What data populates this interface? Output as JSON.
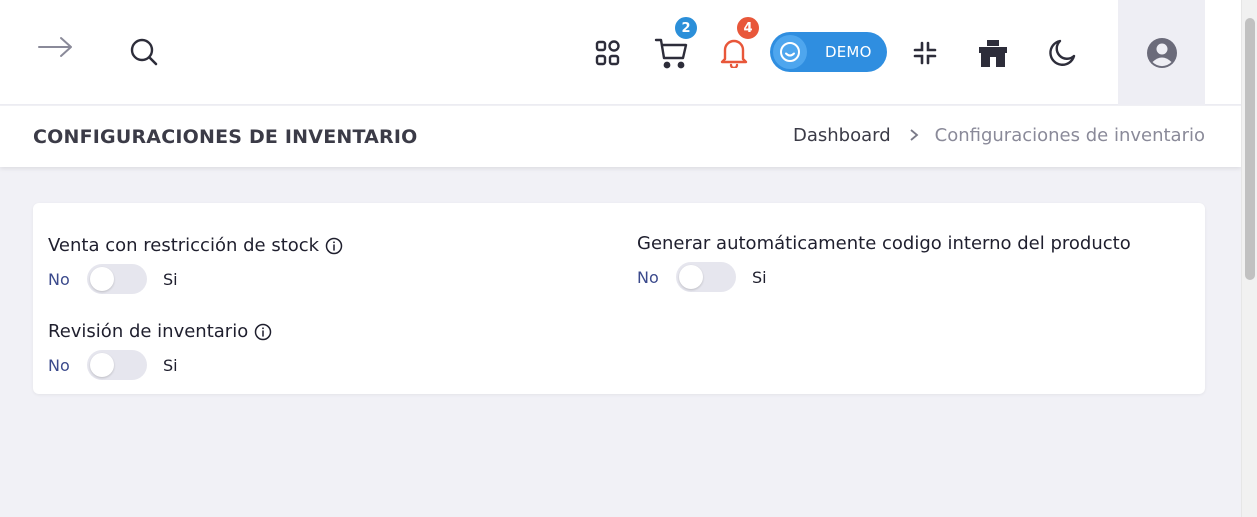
{
  "topbar": {
    "cart_badge": "2",
    "notifications_badge": "4",
    "demo_label": "DEMO"
  },
  "header": {
    "title": "CONFIGURACIONES DE INVENTARIO",
    "breadcrumb": [
      "Dashboard",
      "Configuraciones de inventario"
    ]
  },
  "settings": [
    {
      "title": "Venta con restricción de stock",
      "has_info": true,
      "off_label": "No",
      "on_label": "Si",
      "enabled": false
    },
    {
      "title": "Revisión de inventario",
      "has_info": true,
      "off_label": "No",
      "on_label": "Si",
      "enabled": false
    },
    {
      "title": "Generar automáticamente codigo interno del producto",
      "has_info": false,
      "off_label": "No",
      "on_label": "Si",
      "enabled": false
    }
  ],
  "colors": {
    "cart_badge": "#2b8fd9",
    "notifications_badge": "#e8573a",
    "bell_icon": "#e8573a",
    "demo_pill": "#2f8ee0",
    "toggle_off_track": "#e6e6ee",
    "no_label": "#3b4a8c"
  },
  "icons": [
    "arrow-right-icon",
    "search-icon",
    "apps-grid-icon",
    "cart-icon",
    "bell-icon",
    "smile-icon",
    "minimize-icon",
    "store-icon",
    "moon-icon",
    "user-circle-icon",
    "info-icon"
  ]
}
